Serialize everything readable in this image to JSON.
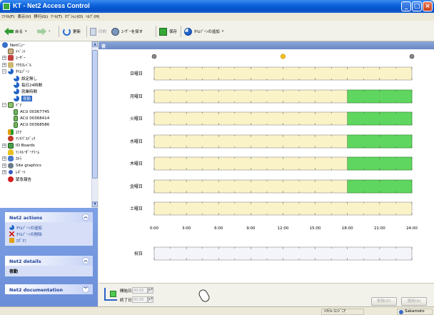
{
  "window": {
    "title": "KT - Net2 Access Control"
  },
  "menu": [
    "ﾌｧｲﾙ(F)",
    "表示(V)",
    "移行(G)",
    "ﾂｰﾙ(T)",
    "ｵﾌﾟｼｮﾝ(O)",
    "ﾍﾙﾌﾟ(H)"
  ],
  "toolbar": {
    "back": "戻る",
    "refresh": "更新",
    "print": "印刷",
    "find_user": "ﾕｰｻﾞｰを探す",
    "save": "保存",
    "add_timezone": "ﾀｲﾑｿﾞｰﾝの追加"
  },
  "tree": [
    {
      "label": "Netﾒﾆｭｰ",
      "icon": "net-icon",
      "indent": 0,
      "exp": ""
    },
    {
      "label": "ｲﾍﾞﾝﾄ",
      "icon": "event-icon",
      "indent": 1,
      "exp": ""
    },
    {
      "label": "ﾕｰｻﾞｰ",
      "icon": "user-icon",
      "indent": 0,
      "exp": "+"
    },
    {
      "label": "ｱｸｾｽﾚﾍﾞﾙ",
      "icon": "access-icon",
      "indent": 0,
      "exp": "+"
    },
    {
      "label": "ﾀｲﾑｿﾞｰﾝ",
      "icon": "timezone-icon",
      "indent": 0,
      "exp": "−"
    },
    {
      "label": "設定無し",
      "icon": "timezone-icon",
      "indent": 2,
      "exp": ""
    },
    {
      "label": "毎日24時間",
      "icon": "timezone-icon",
      "indent": 2,
      "exp": ""
    },
    {
      "label": "就業時間",
      "icon": "timezone-icon",
      "indent": 2,
      "exp": ""
    },
    {
      "label": "夜勤",
      "icon": "timezone-icon",
      "indent": 2,
      "exp": "",
      "selected": true
    },
    {
      "label": "ﾄﾞｱ",
      "icon": "door-icon",
      "indent": 0,
      "exp": "−"
    },
    {
      "label": "ACU 00367745",
      "icon": "acu-icon",
      "indent": 2,
      "exp": ""
    },
    {
      "label": "ACU 00368414",
      "icon": "acu-icon",
      "indent": 2,
      "exp": ""
    },
    {
      "label": "ACU 00368586",
      "icon": "acu-icon",
      "indent": 2,
      "exp": ""
    },
    {
      "label": "ｴﾘｱ",
      "icon": "area-icon",
      "indent": 1,
      "exp": ""
    },
    {
      "label": "ｱﾝﾁﾊﾟｽﾊﾞｯｸ",
      "icon": "antipassback-icon",
      "indent": 1,
      "exp": ""
    },
    {
      "label": "IO Boards",
      "icon": "io-board-icon",
      "indent": 0,
      "exp": "+"
    },
    {
      "label": "ｲﾝﾄﾙｰﾀﾞｰｱﾗｰﾑ",
      "icon": "intruder-alarm-icon",
      "indent": 1,
      "exp": ""
    },
    {
      "label": "ｶﾒﾗ",
      "icon": "camera-icon",
      "indent": 0,
      "exp": "+"
    },
    {
      "label": "Site graphics",
      "icon": "site-graphics-icon",
      "indent": 0,
      "exp": "+"
    },
    {
      "label": "ﾚﾎﾟｰﾄ",
      "icon": "report-icon",
      "indent": 0,
      "exp": "+"
    },
    {
      "label": "緊急報告",
      "icon": "alarm-icon",
      "indent": 1,
      "exp": ""
    }
  ],
  "actions_panel": {
    "title": "Net2 actions",
    "items": [
      "ﾀｲﾑｿﾞｰﾝの追加",
      "ﾀｲﾑｿﾞｰﾝの削除",
      "ﾛｸﾞｵﾌ"
    ]
  },
  "details_panel": {
    "title": "Net2 details",
    "text": "夜勤"
  },
  "doc_panel": {
    "title": "Net2 documentation"
  },
  "main": {
    "header": "夜"
  },
  "timezone": {
    "days": [
      "日曜日",
      "月曜日",
      "火曜日",
      "水曜日",
      "木曜日",
      "金曜日",
      "土曜日"
    ],
    "holiday": "祝日",
    "hours": [
      "0:00",
      "3:00",
      "6:00",
      "9:00",
      "12:00",
      "15:00",
      "18:00",
      "21:00",
      "24:00"
    ],
    "active_ranges": [
      [],
      [
        [
          18,
          24
        ]
      ],
      [
        [
          18,
          24
        ]
      ],
      [
        [
          18,
          24
        ]
      ],
      [
        [
          18,
          24
        ]
      ],
      [
        [
          18,
          24
        ]
      ],
      []
    ],
    "colors": {
      "weekday": "#fbf3c8",
      "active": "#5fd65f",
      "holiday": "#f4f4fb"
    }
  },
  "bottom": {
    "start_label": "開始日",
    "end_label": "終了日",
    "start_value": "00:00",
    "end_value": "00:00",
    "delete_btn": "削除(D)",
    "apply_btn": "適用(A)"
  },
  "status": {
    "mode": "ｼｽﾃﾑ･ｴﾝｼﾞﾆｱ",
    "user": "Sakamoto"
  }
}
